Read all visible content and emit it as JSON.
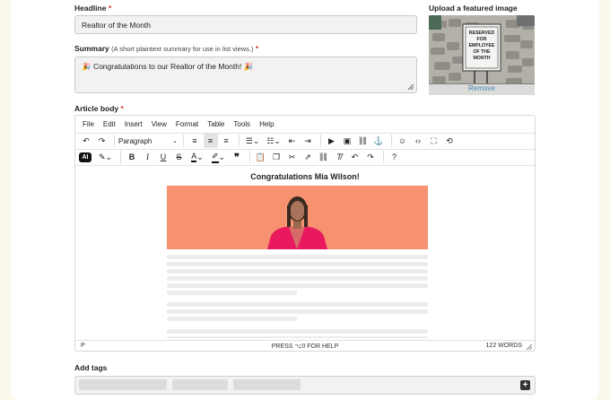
{
  "headline": {
    "label": "Headline",
    "required": "*",
    "value": "Realtor of the Month"
  },
  "summary": {
    "label": "Summary",
    "hint": "(A short plaintext summary for use in list views.)",
    "required": "*",
    "value": "🎉 Congratulations to our Realtor of the Month! 🎉"
  },
  "featured_image": {
    "label": "Upload a featured image",
    "sign_text": "RESERVED FOR EMPLOYEE OF THE MONTH",
    "remove_label": "Remove"
  },
  "article_body": {
    "label": "Article body",
    "required": "*",
    "menu": [
      "File",
      "Edit",
      "Insert",
      "View",
      "Format",
      "Table",
      "Tools",
      "Help"
    ],
    "block_format": "Paragraph",
    "ai_label": "AI",
    "content_heading": "Congratulations Mia Wilson!",
    "status_path": "P",
    "status_help": "PRESS ⌥0 FOR HELP",
    "status_words": "122 WORDS"
  },
  "tags": {
    "label": "Add tags",
    "add_icon": "+"
  },
  "colors": {
    "accent": "#f6926f",
    "jacket": "#e8195e",
    "page_bg": "#fbf7ec"
  }
}
